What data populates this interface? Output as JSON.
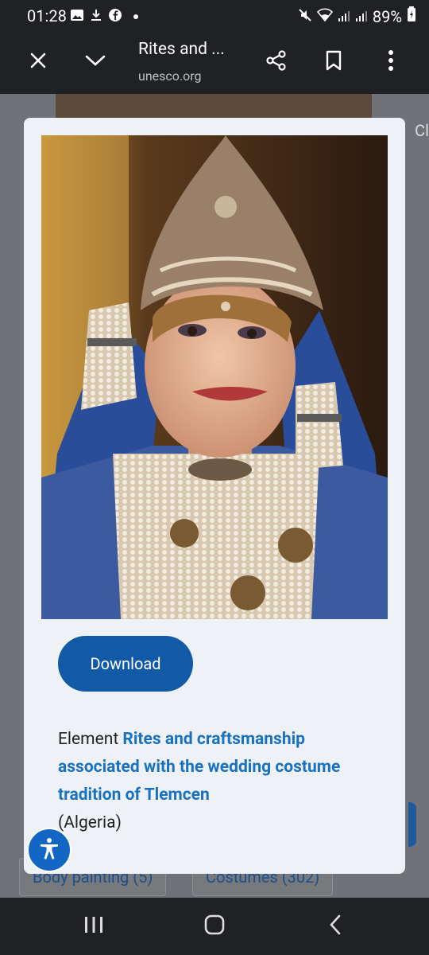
{
  "status": {
    "time": "01:28",
    "battery": "89%"
  },
  "toolbar": {
    "title": "Rites and ...",
    "url": "unesco.org"
  },
  "page": {
    "right_text": "Cl",
    "chips": [
      "Body painting (5)",
      "Costumes (302)"
    ]
  },
  "modal": {
    "download_label": "Download",
    "caption_prefix": "Element ",
    "caption_link": "Rites and craftsmanship associated with the wedding costume tradition of Tlemcen",
    "caption_suffix": "(Algeria)"
  },
  "icons": {
    "close": "close-icon",
    "collapse": "chevron-down-icon",
    "share": "share-icon",
    "bookmark": "bookmark-icon",
    "more": "more-vert-icon",
    "accessibility": "accessibility-icon"
  },
  "colors": {
    "download_button": "#1259a6",
    "link": "#1a72bf",
    "modal_bg": "#eef2f6"
  }
}
